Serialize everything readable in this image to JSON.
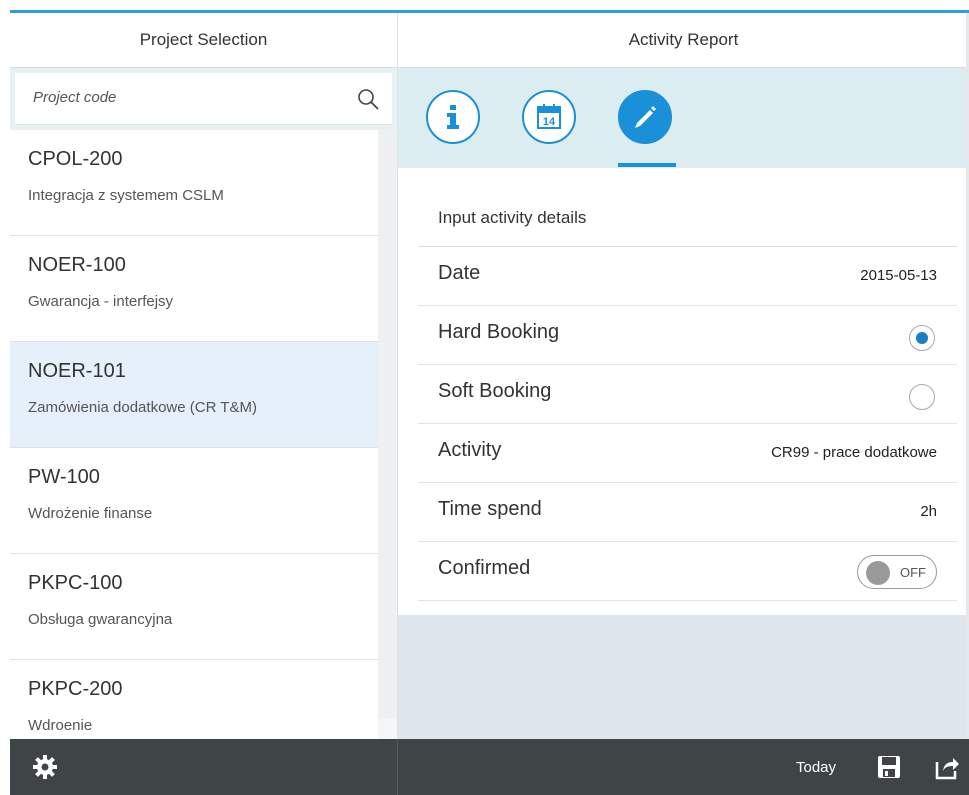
{
  "master": {
    "title": "Project Selection",
    "search": {
      "placeholder": "Project code",
      "icon": "search-icon"
    },
    "items": [
      {
        "code": "CPOL-200",
        "desc": "Integracja z systemem CSLM",
        "selected": false
      },
      {
        "code": "NOER-100",
        "desc": "Gwarancja - interfejsy",
        "selected": false
      },
      {
        "code": "NOER-101",
        "desc": "Zamówienia dodatkowe (CR T&M)",
        "selected": true
      },
      {
        "code": "PW-100",
        "desc": "Wdrożenie finanse",
        "selected": false
      },
      {
        "code": "PKPC-100",
        "desc": "Obsługa gwarancyjna",
        "selected": false
      },
      {
        "code": "PKPC-200",
        "desc": "Wdroenie",
        "selected": false
      }
    ],
    "footer": {
      "settings_icon": "gear-icon"
    }
  },
  "detail": {
    "title": "Activity Report",
    "tabs": [
      {
        "name": "info",
        "icon": "info-icon",
        "active": false
      },
      {
        "name": "calendar",
        "icon": "calendar-icon",
        "calendar_day": "14",
        "active": false
      },
      {
        "name": "edit",
        "icon": "pencil-icon",
        "active": true
      }
    ],
    "section_title": "Input activity details",
    "fields": {
      "date": {
        "label": "Date",
        "value": "2015-05-13"
      },
      "hard_booking": {
        "label": "Hard Booking",
        "selected": true
      },
      "soft_booking": {
        "label": "Soft Booking",
        "selected": false
      },
      "activity": {
        "label": "Activity",
        "value": "CR99 - prace dodatkowe"
      },
      "time_spend": {
        "label": "Time spend",
        "value": "2h"
      },
      "confirmed": {
        "label": "Confirmed",
        "toggle_text": "OFF",
        "on": false
      }
    },
    "footer": {
      "today_label": "Today",
      "save_icon": "save-icon",
      "share_icon": "share-icon"
    }
  },
  "colors": {
    "accent": "#1a90d8",
    "selected_row": "#e5f0fa",
    "footer": "#3f4447",
    "tabbar": "#dbedf1"
  }
}
